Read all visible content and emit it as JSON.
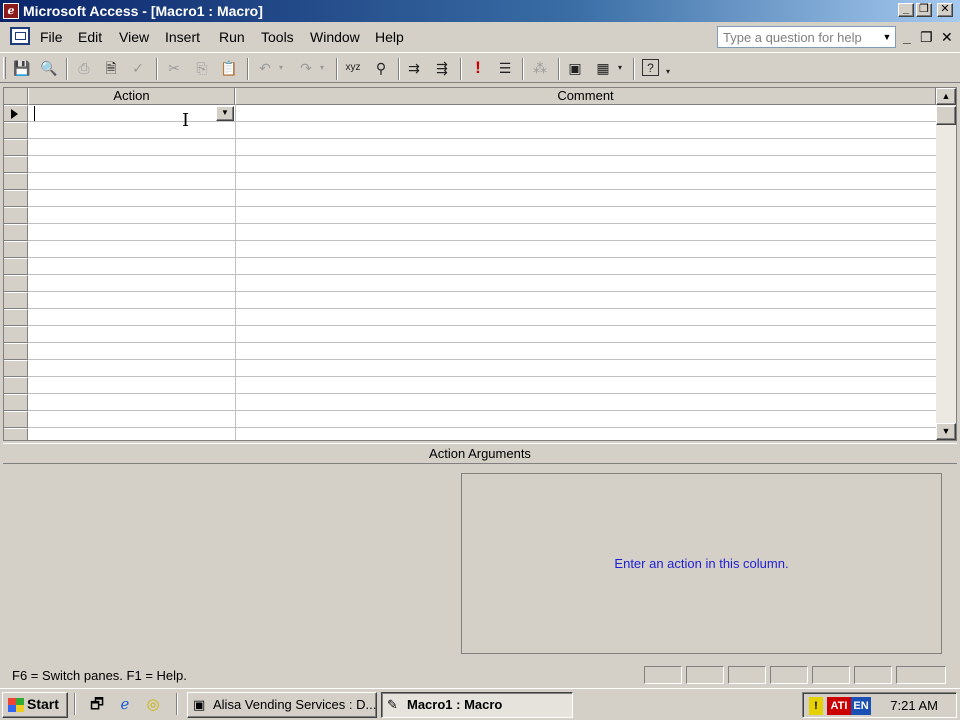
{
  "window": {
    "title": "Microsoft Access - [Macro1 : Macro]",
    "minimize": "_",
    "restore": "❐",
    "close": "✕"
  },
  "menu": {
    "items": [
      "File",
      "Edit",
      "View",
      "Insert",
      "Run",
      "Tools",
      "Window",
      "Help"
    ],
    "help_placeholder": "Type a question for help",
    "mdi_minimize": "_",
    "mdi_restore": "❐",
    "mdi_close": "✕"
  },
  "toolbar": {
    "icons": [
      "save-icon",
      "print-preview-db-icon",
      "print-icon",
      "print-preview-icon",
      "spelling-icon",
      "cut-icon",
      "copy-icon",
      "paste-icon",
      "undo-icon",
      "redo-icon",
      "macro-names-icon",
      "conditions-icon",
      "insert-rows-icon",
      "delete-rows-icon",
      "run-icon",
      "single-step-icon",
      "build-icon",
      "database-window-icon",
      "new-object-icon",
      "help-icon"
    ]
  },
  "grid": {
    "columns": [
      "Action",
      "Comment"
    ],
    "row_count": 19
  },
  "args": {
    "header": "Action Arguments",
    "help_text": "Enter an action in this column."
  },
  "status": {
    "text": "F6 = Switch panes.  F1 = Help."
  },
  "taskbar": {
    "start_label": "Start",
    "tasks": [
      {
        "label": "Alisa Vending Services : D...",
        "active": false
      },
      {
        "label": "Macro1 : Macro",
        "active": true
      }
    ],
    "tray_lang": "EN",
    "clock": "7:21 AM"
  }
}
